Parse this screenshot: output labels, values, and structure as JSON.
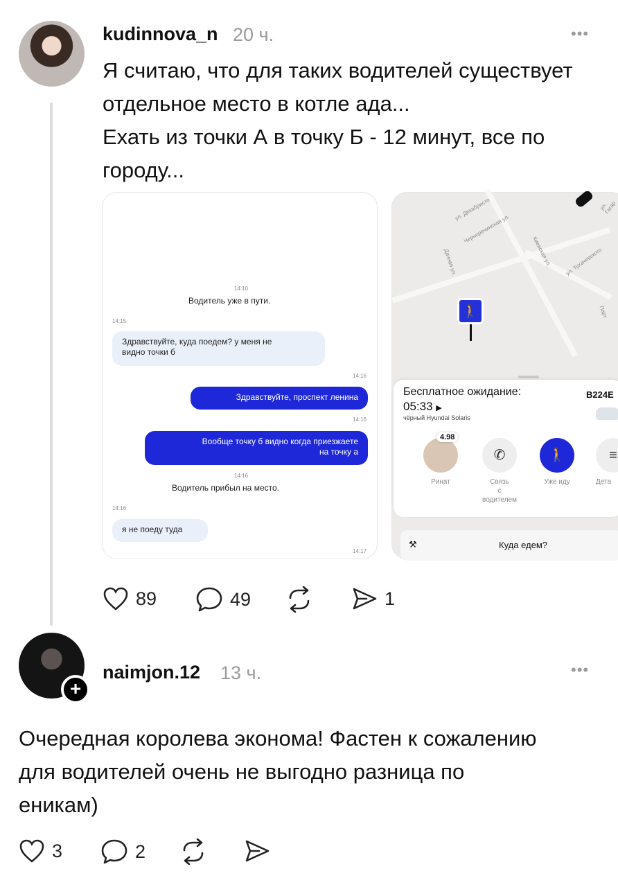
{
  "post1": {
    "username": "kudinnova_n",
    "time": "20 ч.",
    "more": "•••",
    "text_lines": [
      "Я считаю, что для таких водителей существует",
      "отдельное место в котле ада...",
      "Ехать из точки А в точку Б - 12 минут, все по",
      "городу..."
    ],
    "chat": {
      "ts1": "14:10",
      "sys1": "Водитель уже в пути.",
      "ts2": "14:15",
      "msg1_line1": "Здравствуйте, куда поедем? у меня не",
      "msg1_line2": "видно точки б",
      "ts3": "14:16",
      "msg2": "Здравствуйте, проспект ленина",
      "ts4": "14:16",
      "msg3_line1": "Вообще точку б видно когда приезжаете",
      "msg3_line2": "на точку а",
      "ts5": "14:16",
      "sys2": "Водитель прибыл на место.",
      "ts6": "14:16",
      "msg4": "я не поеду туда",
      "ts7": "14:17"
    },
    "map": {
      "streets": [
        "ул. Декабристо",
        "Черноречинская ул.",
        "Дачная ул.",
        "Киевская ул.",
        "ул. Тухачевского",
        "ул. Гагар",
        "Парт"
      ],
      "free_wait_label": "Бесплатное ожидание:",
      "timer": "05:33",
      "car_model": "чёрный Hyundai Solaris",
      "plate": "В224Е",
      "rating": "4.98",
      "driver_name": "Ринат",
      "contact_label_1": "Связь",
      "contact_label_2": "с",
      "contact_label_3": "водителем",
      "going_label": "Уже иду",
      "details_label": "Дета",
      "where_label": "Куда едем?"
    },
    "likes": "89",
    "comments": "49",
    "shares": "1"
  },
  "post2": {
    "username": "naimjon.12",
    "time": "13 ч.",
    "more": "•••",
    "follow_icon": "+",
    "text_lines": [
      "Очередная королева эконома! Фастен к сожалению",
      "для водителей очень не выгодно разница по",
      "еникам)"
    ],
    "likes": "3",
    "comments": "2"
  }
}
